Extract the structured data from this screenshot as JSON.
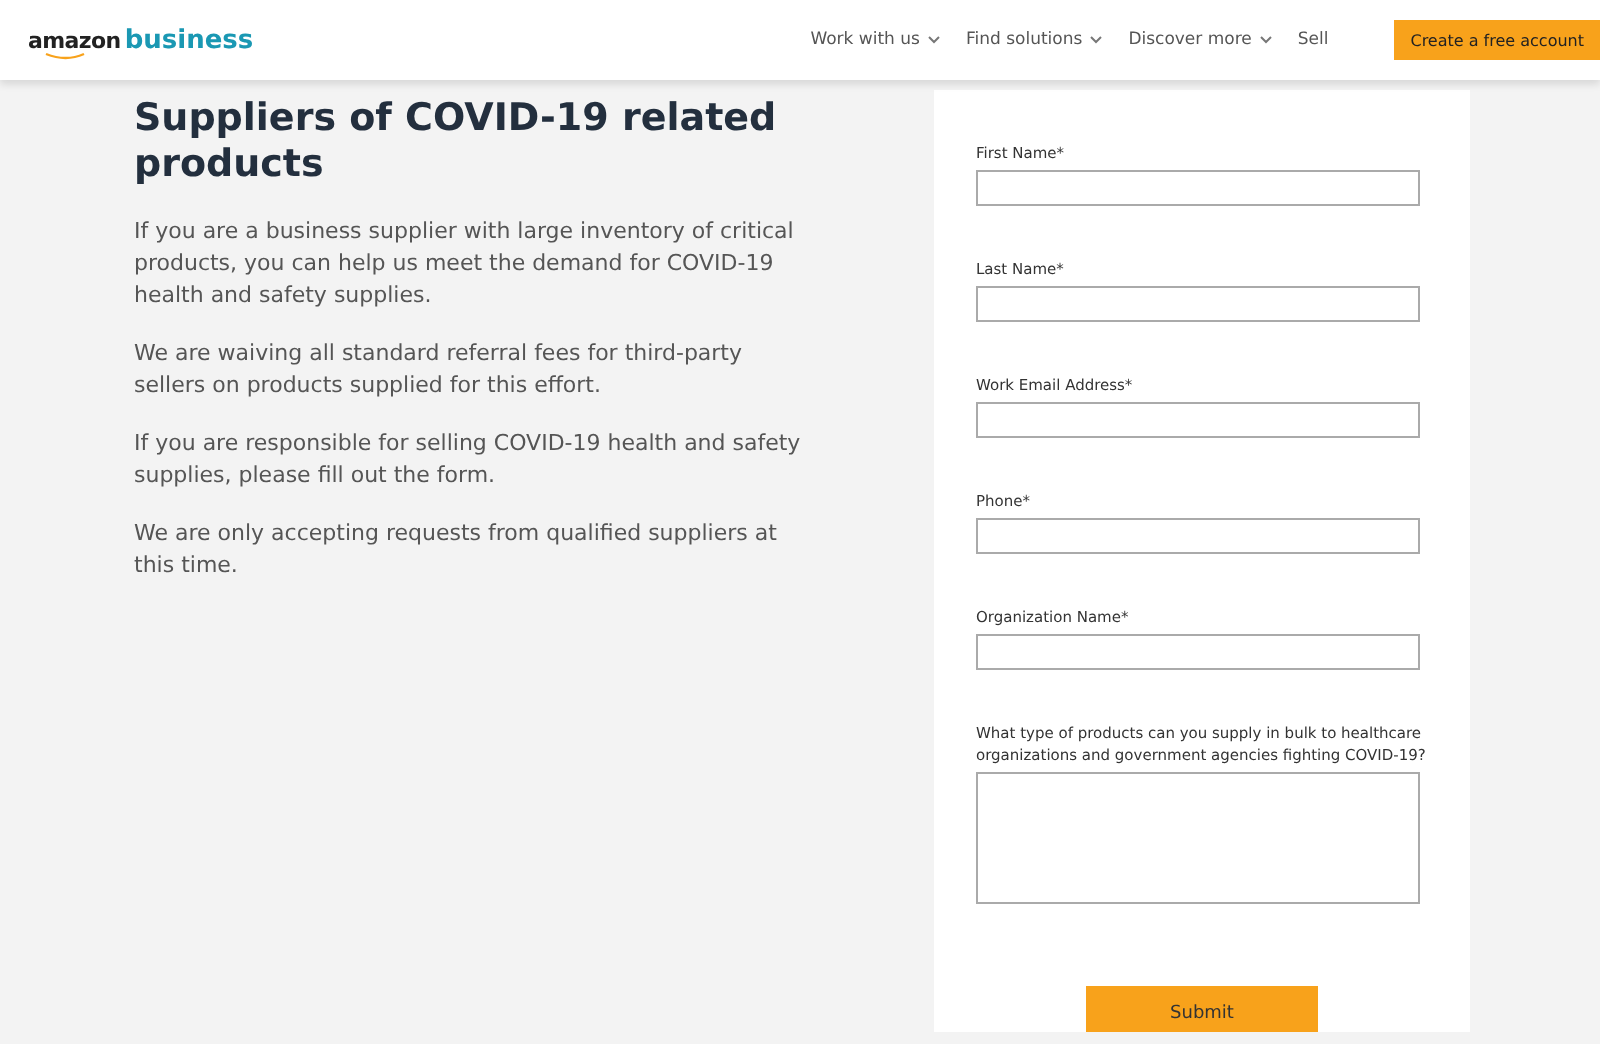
{
  "header": {
    "logo": {
      "brand": "amazon",
      "product": "business"
    },
    "nav": [
      {
        "label": "Work with us",
        "dropdown": true
      },
      {
        "label": "Find solutions",
        "dropdown": true
      },
      {
        "label": "Discover more",
        "dropdown": true
      },
      {
        "label": "Sell",
        "dropdown": false
      }
    ],
    "cta": "Create a free account"
  },
  "intro": {
    "title": "Suppliers of COVID-19 related products",
    "paragraphs": [
      "If you are a business supplier with large inventory of critical products, you can help us meet the demand for COVID-19 health and safety supplies.",
      "We are waiving all standard referral fees for third-party sellers on products supplied for this effort.",
      "If you are responsible for selling COVID-19 health and safety supplies, please fill out the form.",
      "We are only accepting requests from qualified suppliers at this time."
    ]
  },
  "form": {
    "fields": [
      {
        "label": "First Name*",
        "kind": "text"
      },
      {
        "label": "Last Name*",
        "kind": "text"
      },
      {
        "label": "Work Email Address*",
        "kind": "text"
      },
      {
        "label": "Phone*",
        "kind": "text"
      },
      {
        "label": "Organization Name*",
        "kind": "text"
      },
      {
        "label": "What type of products can you supply in bulk to healthcare organizations and government agencies fighting COVID-19?",
        "kind": "textarea"
      }
    ],
    "submit": "Submit"
  }
}
